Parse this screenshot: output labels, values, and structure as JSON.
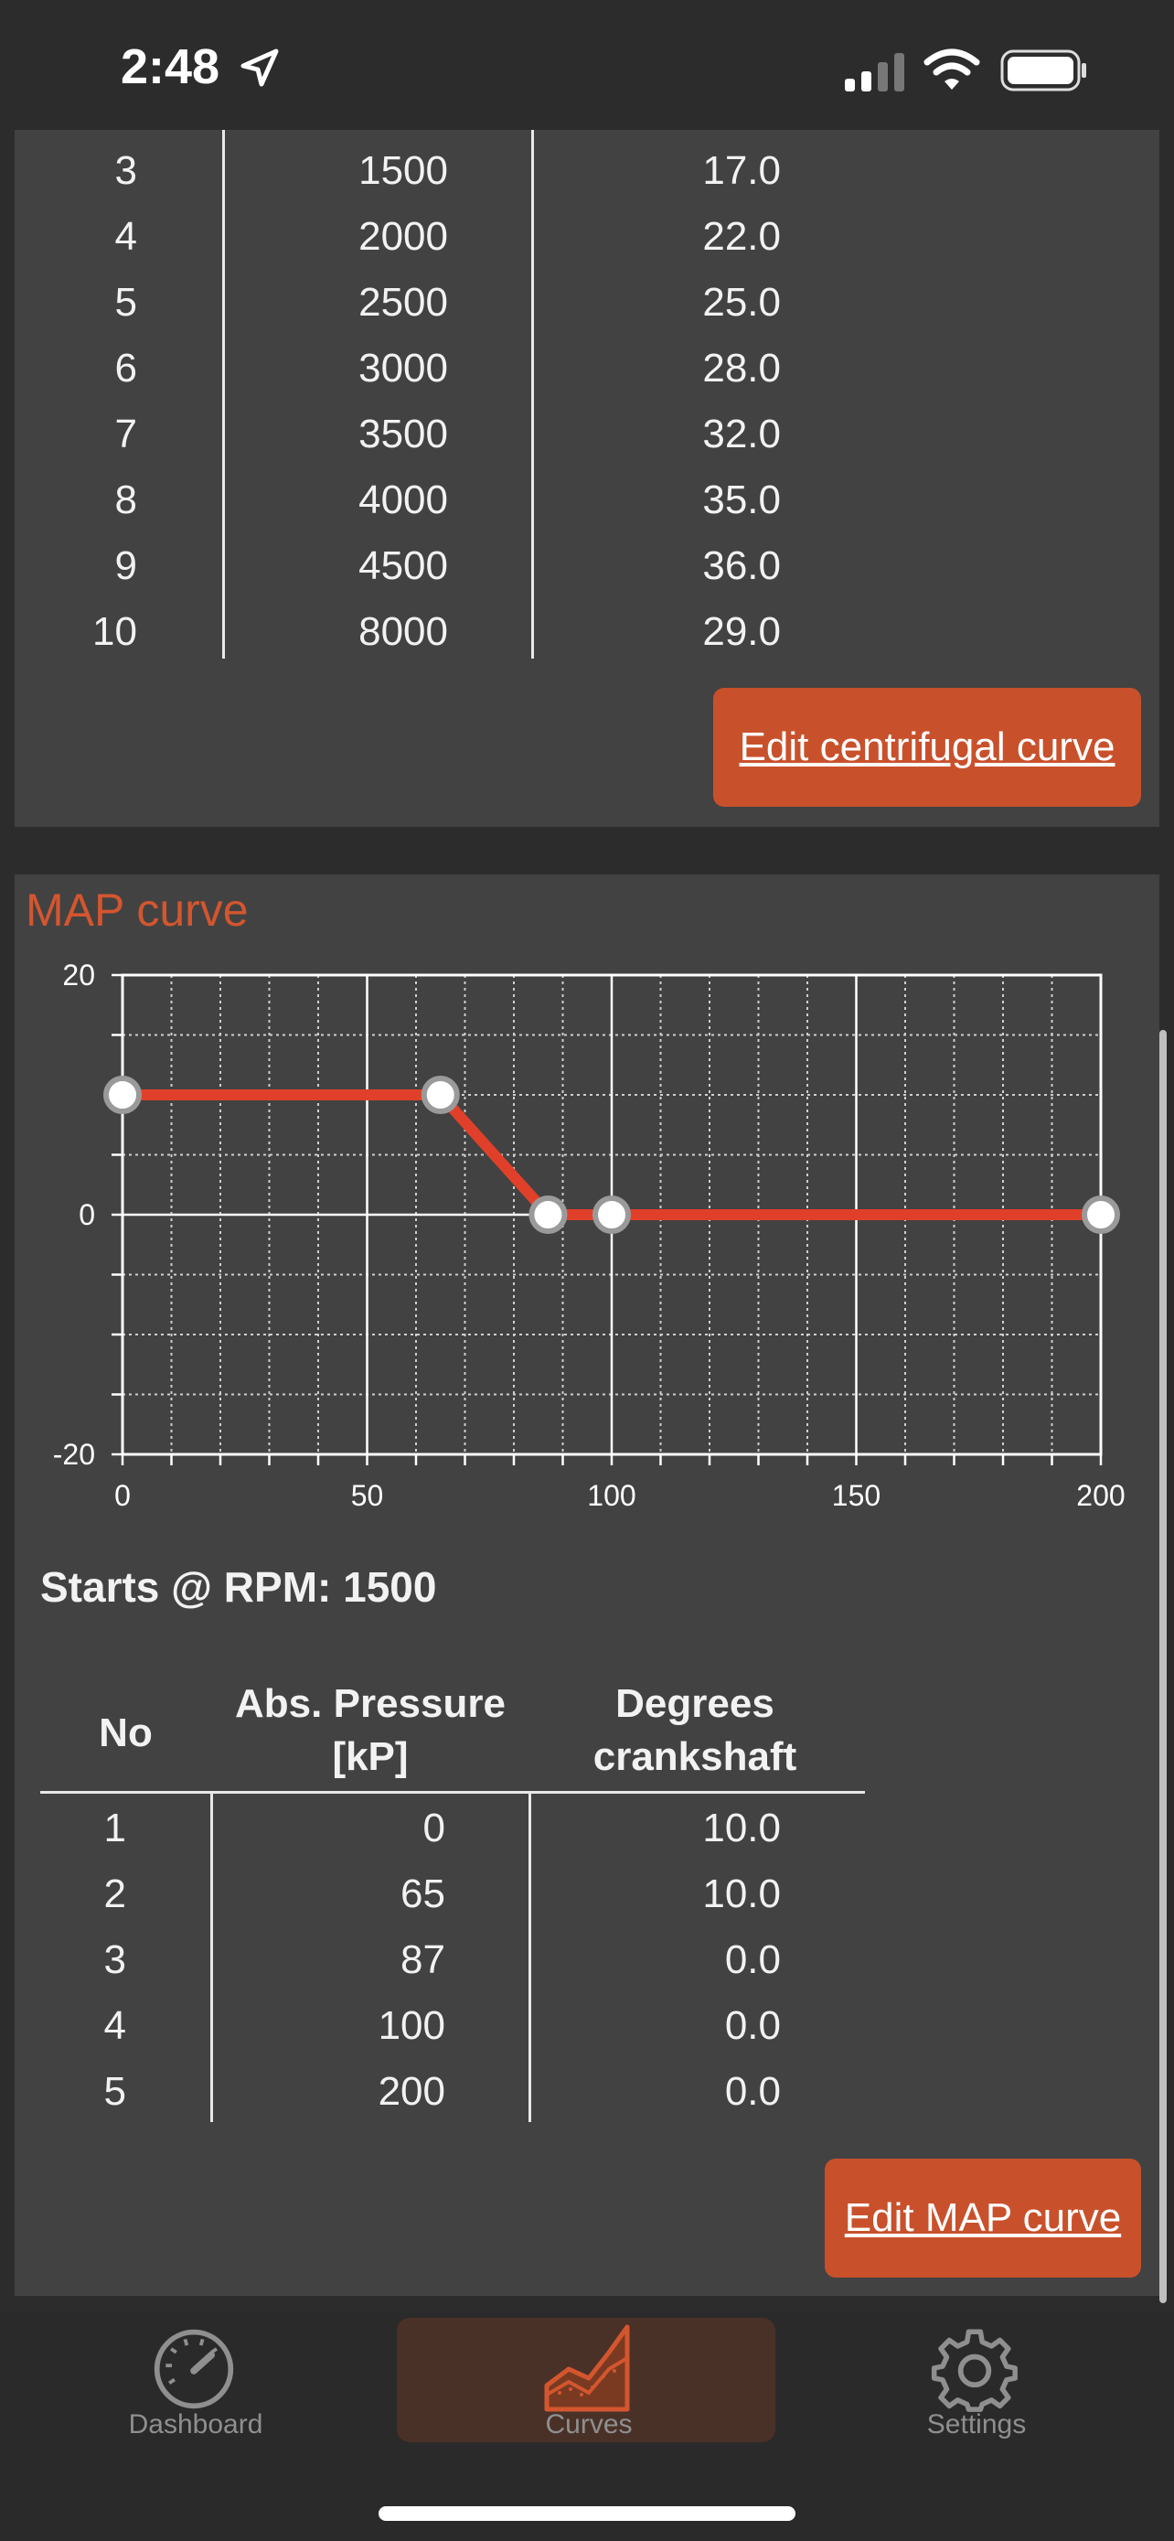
{
  "status_bar": {
    "time": "2:48"
  },
  "centrifugal": {
    "rows": [
      {
        "no": "3",
        "rpm": "1500",
        "deg": "17.0"
      },
      {
        "no": "4",
        "rpm": "2000",
        "deg": "22.0"
      },
      {
        "no": "5",
        "rpm": "2500",
        "deg": "25.0"
      },
      {
        "no": "6",
        "rpm": "3000",
        "deg": "28.0"
      },
      {
        "no": "7",
        "rpm": "3500",
        "deg": "32.0"
      },
      {
        "no": "8",
        "rpm": "4000",
        "deg": "35.0"
      },
      {
        "no": "9",
        "rpm": "4500",
        "deg": "36.0"
      },
      {
        "no": "10",
        "rpm": "8000",
        "deg": "29.0"
      }
    ],
    "edit_button": "Edit centrifugal curve"
  },
  "map": {
    "title": "MAP curve",
    "starts_label": "Starts @ RPM:",
    "starts_value": "1500",
    "headers": {
      "no": "No",
      "pressure_line1": "Abs. Pressure",
      "pressure_line2": "[kP]",
      "degrees_line1": "Degrees",
      "degrees_line2": "crankshaft"
    },
    "rows": [
      {
        "no": "1",
        "pressure": "0",
        "deg": "10.0"
      },
      {
        "no": "2",
        "pressure": "65",
        "deg": "10.0"
      },
      {
        "no": "3",
        "pressure": "87",
        "deg": "0.0"
      },
      {
        "no": "4",
        "pressure": "100",
        "deg": "0.0"
      },
      {
        "no": "5",
        "pressure": "200",
        "deg": "0.0"
      }
    ],
    "edit_button": "Edit MAP curve"
  },
  "chart_data": {
    "type": "line",
    "x": [
      0,
      65,
      87,
      100,
      200
    ],
    "series": [
      {
        "values": [
          10,
          10,
          0,
          0,
          0
        ]
      }
    ],
    "xlim": [
      0,
      200
    ],
    "ylim": [
      -20,
      20
    ],
    "x_ticks": [
      "0",
      "50",
      "100",
      "150",
      "200"
    ],
    "y_ticks": [
      "20",
      "0",
      "-20"
    ],
    "grid": true,
    "line_color": "#e0402a",
    "marker_color": "#ffffff"
  },
  "tabs": [
    {
      "label": "Dashboard",
      "icon": "speedometer-icon",
      "active": false
    },
    {
      "label": "Curves",
      "icon": "chart-area-icon",
      "active": true
    },
    {
      "label": "Settings",
      "icon": "gear-icon",
      "active": false
    }
  ],
  "colors": {
    "accent": "#c8512c",
    "title": "#d3562f",
    "card": "#424242",
    "background": "#2c2c2c"
  }
}
